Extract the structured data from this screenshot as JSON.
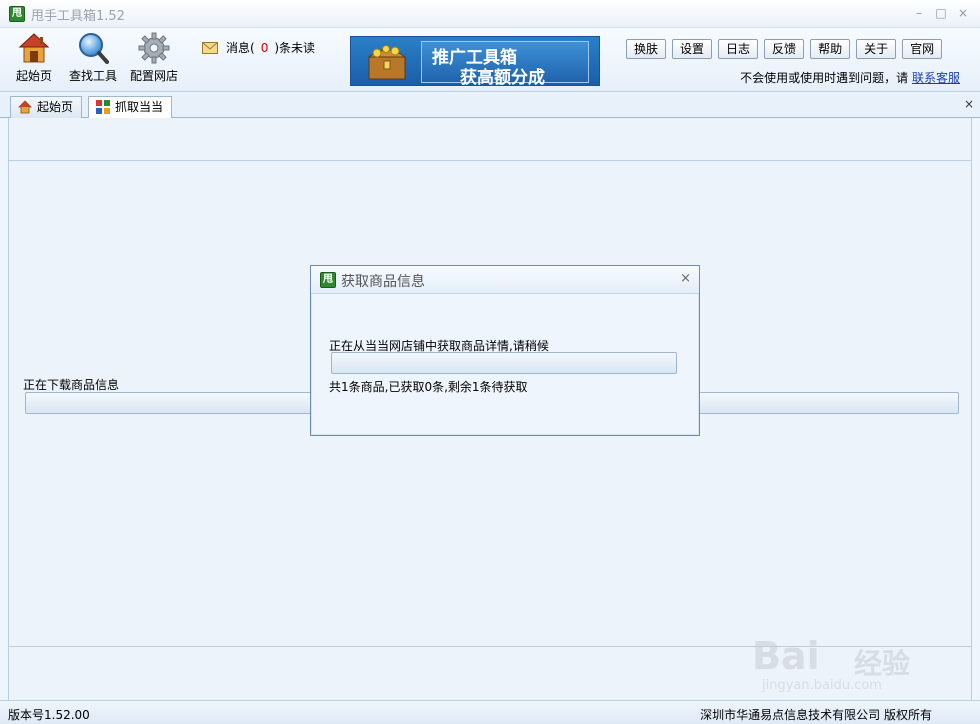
{
  "window": {
    "logo_char": "甩",
    "title": "甩手工具箱1.52",
    "minimize": "–",
    "maximize": "□",
    "close": "×"
  },
  "toolbar": {
    "home_label": "起始页",
    "find_tool_label": "查找工具",
    "config_shop_label": "配置网店",
    "message_prefix": "消息(",
    "message_count": "0",
    "message_suffix": ")条未读",
    "promo_line1": "推广工具箱",
    "promo_line2": "获高额分成",
    "buttons": [
      "换肤",
      "设置",
      "日志",
      "反馈",
      "帮助",
      "关于",
      "官网"
    ],
    "help_text": "不会使用或使用时遇到问题，请",
    "help_link": "联系客服"
  },
  "tabs": {
    "items": [
      {
        "label": "起始页",
        "active": false
      },
      {
        "label": "抓取当当",
        "active": true
      }
    ],
    "close": "×"
  },
  "content": {
    "download_label": "正在下载商品信息",
    "download_progress": 0
  },
  "dialog": {
    "logo_char": "甩",
    "title": "获取商品信息",
    "close": "×",
    "status_text": "正在从当当网店铺中获取商品详情,请稍候",
    "progress": 0,
    "count_text": "共1条商品,已获取0条,剩余1条待获取"
  },
  "statusbar": {
    "version": "版本号1.52.00",
    "copyright": "深圳市华通易点信息技术有限公司  版权所有"
  },
  "watermark": {
    "brand": "Bai",
    "brand_cn": "经验",
    "url": "jingyan.baidu.com"
  },
  "colors": {
    "accent": "#1b5ea8",
    "message_count": "#d40000",
    "link": "#1a3fa8",
    "logo_green": "#2f8a2f"
  }
}
